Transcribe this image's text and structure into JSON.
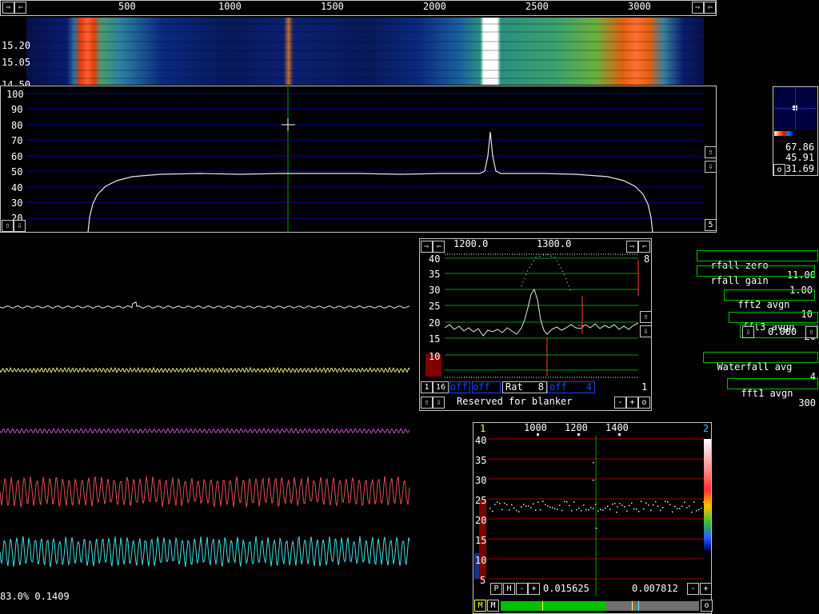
{
  "top_scale": {
    "labels": [
      "500",
      "1000",
      "1500",
      "2000",
      "2500",
      "3000"
    ]
  },
  "waterfall": {
    "labels": [
      "15.20",
      "15.05",
      "14.50"
    ]
  },
  "spectrum": {
    "y_labels": [
      "100",
      "90",
      "80",
      "70",
      "60",
      "50",
      "40",
      "30",
      "20"
    ],
    "right_value": "5"
  },
  "nav_buttons": {
    "left": "⇦",
    "right": "⇨",
    "up": "⇧",
    "down": "⇩"
  },
  "mini_panel": {
    "values": [
      "67.86",
      "45.91",
      "31.69"
    ],
    "o_label": "o"
  },
  "right_controls": {
    "waterfall_zero": {
      "label": "rfall zero",
      "value": "11.00"
    },
    "waterfall_gain": {
      "label": "rfall gain",
      "value": "1.00"
    },
    "fft2_avgn": {
      "label": "fft2 avgn",
      "value": "10"
    },
    "fft3_avgn": {
      "label": "fft3 avgn",
      "value": "20"
    },
    "fft3_value": "0.000",
    "waterfall_avg": {
      "label": "Waterfall avg",
      "value": "4"
    },
    "fft1_avgn": {
      "label": "fft1 avgn",
      "value": "300"
    }
  },
  "baseband": {
    "freq_labels": [
      "1200.0",
      "1300.0"
    ],
    "y_labels": [
      "40",
      "35",
      "30",
      "25",
      "20",
      "15",
      "10"
    ],
    "right_marker": "8",
    "controls": {
      "b1": "1",
      "b16": "16",
      "off1": "off",
      "off2": "off",
      "rat_label": "Rat",
      "rat_value": "8",
      "off3": "off",
      "off3_value": "4",
      "right_num": "1"
    },
    "blanker_text": "Reserved for blanker",
    "small_btns": {
      "minus": "-",
      "plus": "+",
      "o": "o"
    }
  },
  "fft3": {
    "top_left": "1",
    "top_right": "2",
    "freq_labels": [
      "1000",
      "1200",
      "1400"
    ],
    "y_labels": [
      "40",
      "35",
      "30",
      "25",
      "20",
      "15",
      "10",
      "5"
    ],
    "bottom_left_value": "0.015625",
    "bottom_right_value": "0.007812",
    "btn_P": "P",
    "btn_H": "H",
    "btn_minus": "-",
    "btn_plus": "+",
    "btn_M1": "M",
    "btn_M2": "M",
    "btn_o": "o"
  },
  "status_text": "83.0% 0.1409",
  "colors": {
    "grid_blue": "#0000b0",
    "grid_green": "#00a000",
    "grid_red": "#a00000",
    "waveform_1": "#e8e8e8",
    "waveform_2": "#e6e680",
    "waveform_3": "#c050c8",
    "waveform_4": "#e05050",
    "waveform_5": "#40e0e0"
  }
}
